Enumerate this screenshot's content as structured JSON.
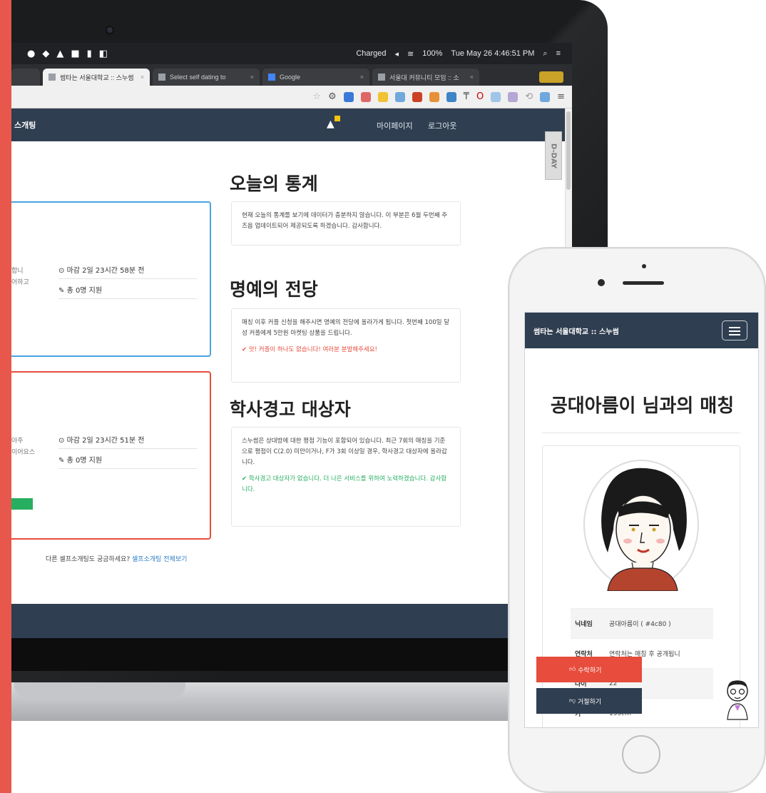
{
  "menubar": {
    "charged": "Charged",
    "battery": "100%",
    "datetime": "Tue May 26  4:46:51 PM"
  },
  "tabs": [
    {
      "label": "썸타는 서울대학교 :: 스누썸",
      "active": true
    },
    {
      "label": "Select self dating to",
      "active": false
    },
    {
      "label": "Google",
      "active": false
    },
    {
      "label": "서울대 커뮤니티 모임 :: 소",
      "active": false
    }
  ],
  "site_nav": {
    "brand_fragment": "스개팅",
    "links": [
      "마이페이지",
      "로그아웃"
    ]
  },
  "side_tab": "D-DAY",
  "cards": [
    {
      "meta_time": "마감 2일 23시간 58분 전",
      "meta_count": "총 0명 지원",
      "frags": [
        "합니",
        "어하고"
      ],
      "accent": "#4aa3df"
    },
    {
      "meta_time": "마감 2일 23시간 51분 전",
      "meta_count": "총 0명 지원",
      "frags": [
        "아주",
        "이어요스"
      ],
      "accent": "#e74c3c"
    }
  ],
  "bottom_link": {
    "text": "다른 셀프소개팅도 궁금하세요?",
    "link": "셀프소개팅 전체보기"
  },
  "sections": [
    {
      "title": "오늘의 통계",
      "body": "현재 오늘의 통계를 보기에 데이터가 충분하지 않습니다. 이 부분은 6월 두번째 주 즈음 업데이트되어 제공되도록 하겠습니다. 감사합니다."
    },
    {
      "title": "명예의 전당",
      "body": "매칭 이후 커플 신청을 해주시면 명예의 전당에 올라가게 됩니다. 첫번째 100일 달성 커플에게 5만원 마켓팅 상품을 드립니다.",
      "note": "✔ 앗! 커플이 하나도 없습니다! 여러분 분발해주세요!"
    },
    {
      "title": "학사경고 대상자",
      "body": "스누썸은 상대방에 대한 평점 기능이 포함되어 있습니다. 최근 7회의 매칭을 기준으로 평점이 C(2.0) 미만이거나, F가 3회 이상일 경우, 학사경고 대상자에 올라갑니다.",
      "note": "✔ 학사경고 대상자가 없습니다. 더 나은 서비스를 위하여 노력하겠습니다. 감사합니다."
    }
  ],
  "phone": {
    "brand": "썸타는 서울대학교 :: 스누썸",
    "heading": "공대아름이 님과의 매칭",
    "info": [
      {
        "key": "닉네임",
        "value": "공대아름이 ( #4c80 )"
      },
      {
        "key": "연락처",
        "value": "연락처는 매칭 후 공개됩니"
      },
      {
        "key": "나이",
        "value": "22"
      },
      {
        "key": "키",
        "value": "155cm"
      }
    ],
    "accept_label": "수락하기",
    "reject_label": "거절하기"
  },
  "colors": {
    "navbar": "#2f3e50",
    "accent_red": "#e74c3c",
    "accent_blue": "#4aa3df",
    "accent_green": "#27ae60"
  }
}
